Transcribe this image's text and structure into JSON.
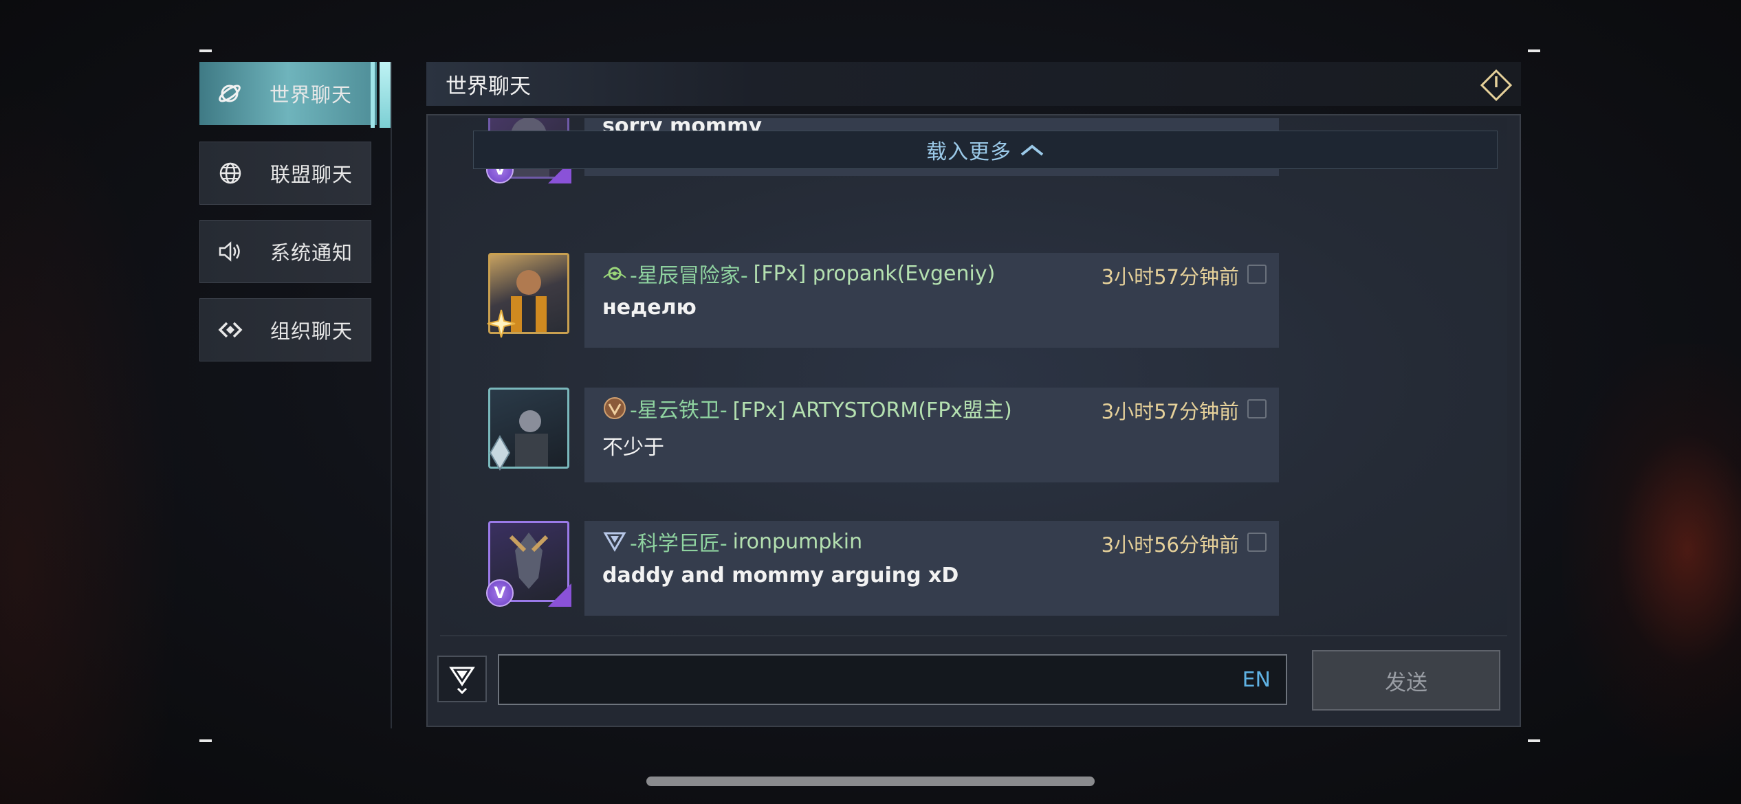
{
  "sidebar": {
    "items": [
      {
        "label": "世界聊天",
        "icon": "planet-icon",
        "active": true
      },
      {
        "label": "联盟聊天",
        "icon": "globe-icon",
        "active": false
      },
      {
        "label": "系统通知",
        "icon": "speaker-icon",
        "active": false
      },
      {
        "label": "组织聊天",
        "icon": "link-icon",
        "active": false
      }
    ]
  },
  "header": {
    "title": "世界聊天",
    "exit_icon": "exit-icon"
  },
  "chat": {
    "load_more": "载入更多",
    "messages": [
      {
        "text": "sorry mommy",
        "level_badge": "V"
      },
      {
        "title": "-星辰冒险家-",
        "name": "[FPx] propank(Evgeniy)",
        "time": "3小时57分钟前",
        "text": "неделю"
      },
      {
        "title": "-星云铁卫-",
        "name": "[FPx] ARTYSTORM(FPx盟主)",
        "time": "3小时57分钟前",
        "text": "不少于"
      },
      {
        "title": "-科学巨匠-",
        "name": "ironpumpkin",
        "time": "3小时56分钟前",
        "text": "daddy and mommy arguing xD",
        "level_badge": "V"
      }
    ]
  },
  "input": {
    "value": "",
    "lang": "EN",
    "send_label": "发送"
  },
  "colors": {
    "accent": "#6fb4bc",
    "title_green": "#8fd3a0",
    "time_gold": "#e6d19a",
    "link_blue": "#9bc9e8"
  }
}
